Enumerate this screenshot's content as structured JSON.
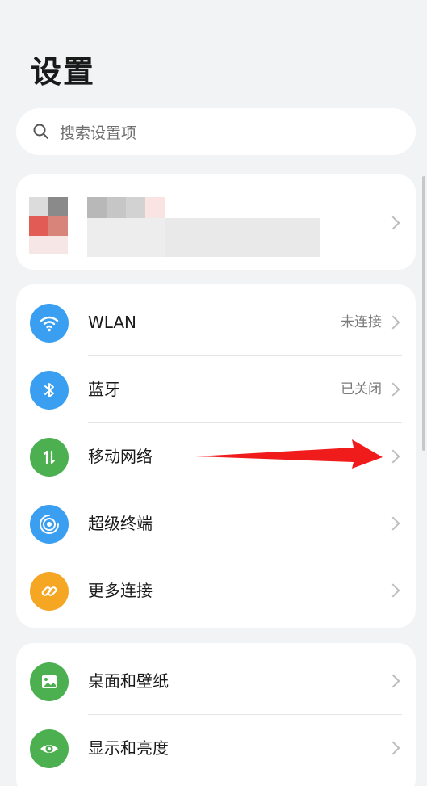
{
  "header": {
    "title": "设置"
  },
  "search": {
    "placeholder": "搜索设置项",
    "icon": "search-icon"
  },
  "account": {
    "icon": "chevron-right-icon"
  },
  "connectivity": {
    "items": [
      {
        "label": "WLAN",
        "value": "未连接",
        "icon": "wifi-icon",
        "color": "#3a9ff0"
      },
      {
        "label": "蓝牙",
        "value": "已关闭",
        "icon": "bluetooth-icon",
        "color": "#3a9ff0"
      },
      {
        "label": "移动网络",
        "value": "",
        "icon": "mobile-data-icon",
        "color": "#4caf50"
      },
      {
        "label": "超级终端",
        "value": "",
        "icon": "super-device-icon",
        "color": "#3a9ff0"
      },
      {
        "label": "更多连接",
        "value": "",
        "icon": "link-icon",
        "color": "#f5a623"
      }
    ]
  },
  "display": {
    "items": [
      {
        "label": "桌面和壁纸",
        "icon": "wallpaper-icon",
        "color": "#4caf50"
      },
      {
        "label": "显示和亮度",
        "icon": "eye-icon",
        "color": "#4caf50"
      }
    ]
  },
  "annotation": {
    "arrow_color": "#f01c1c"
  }
}
